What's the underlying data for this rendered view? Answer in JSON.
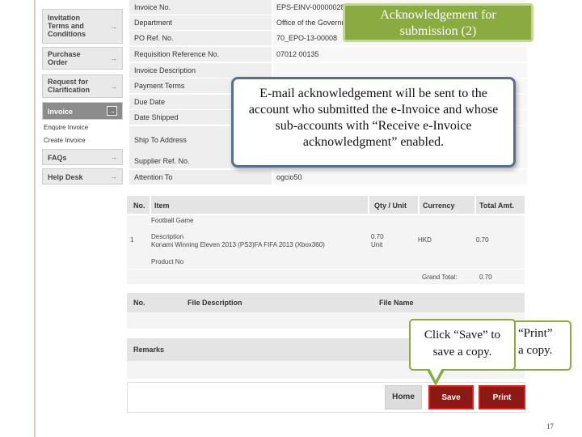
{
  "sidebar": {
    "items": [
      {
        "label": "Invitation Terms and Conditions",
        "arrow": "→"
      },
      {
        "label": "Purchase Order",
        "arrow": "→"
      },
      {
        "label": "Request for Clarification",
        "arrow": "→"
      },
      {
        "label": "Invoice",
        "arrow": "→"
      },
      {
        "label": "FAQs",
        "arrow": "→"
      },
      {
        "label": "Help Desk",
        "arrow": "→"
      }
    ],
    "subitems": [
      "Enquire Invoice",
      "Create Invoice"
    ]
  },
  "form": {
    "rows": [
      {
        "label": "Invoice No.",
        "value": "EPS-EINV-00000028"
      },
      {
        "label": "Department",
        "value": "Office of the Government"
      },
      {
        "label": "PO Ref. No.",
        "value": "70_EPO-13-00008"
      },
      {
        "label": "Requisition Reference No.",
        "value": "07012 00135"
      },
      {
        "label": "Invoice Description",
        "value": ""
      },
      {
        "label": "Payment Terms",
        "value": ""
      },
      {
        "label": "Due Date",
        "value": ""
      },
      {
        "label": "Date Shipped",
        "value": ""
      },
      {
        "label": "Ship To Address",
        "value": ""
      },
      {
        "label": "Supplier Ref. No.",
        "value": ""
      },
      {
        "label": "Attention To",
        "value": "ogcio50"
      }
    ]
  },
  "items": {
    "headers": [
      "No.",
      "Item",
      "Qty / Unit",
      "Currency",
      "Total Amt."
    ],
    "rows": [
      {
        "no": "1",
        "category": "Football Game",
        "desc_label": "Description",
        "desc": "Konami Winning Eleven 2013 (PS3)FA FIFA 2013 (Xbox360)",
        "product_label": "Product No",
        "qty": "0.70",
        "unit": "Unit",
        "currency": "HKD",
        "total": "0.70"
      }
    ],
    "grand_total_label": "Grand Total:",
    "grand_total": "0.70"
  },
  "files": {
    "headers": [
      "No.",
      "File Description",
      "File Name"
    ]
  },
  "remarks_label": "Remarks",
  "buttons": {
    "home": "Home",
    "save": "Save",
    "print": "Print"
  },
  "callouts": {
    "title_line1": "Acknowledgement for",
    "title_line2": "submission (2)",
    "email_note": "E-mail acknowledgement will be sent to the account who submitted the e-Invoice and whose sub-accounts with “Receive e-Invoice acknowledgment” enabled.",
    "save_note": "Click “Save” to save a copy.",
    "print_note_line1": "“Print”",
    "print_note_line2": "a copy."
  },
  "page_number": "17",
  "colors": {
    "callout_green": "#8aab3f",
    "callout_blue_border": "#56708f",
    "button_red": "#8b1a14",
    "highlight_red": "#e81b1b"
  }
}
